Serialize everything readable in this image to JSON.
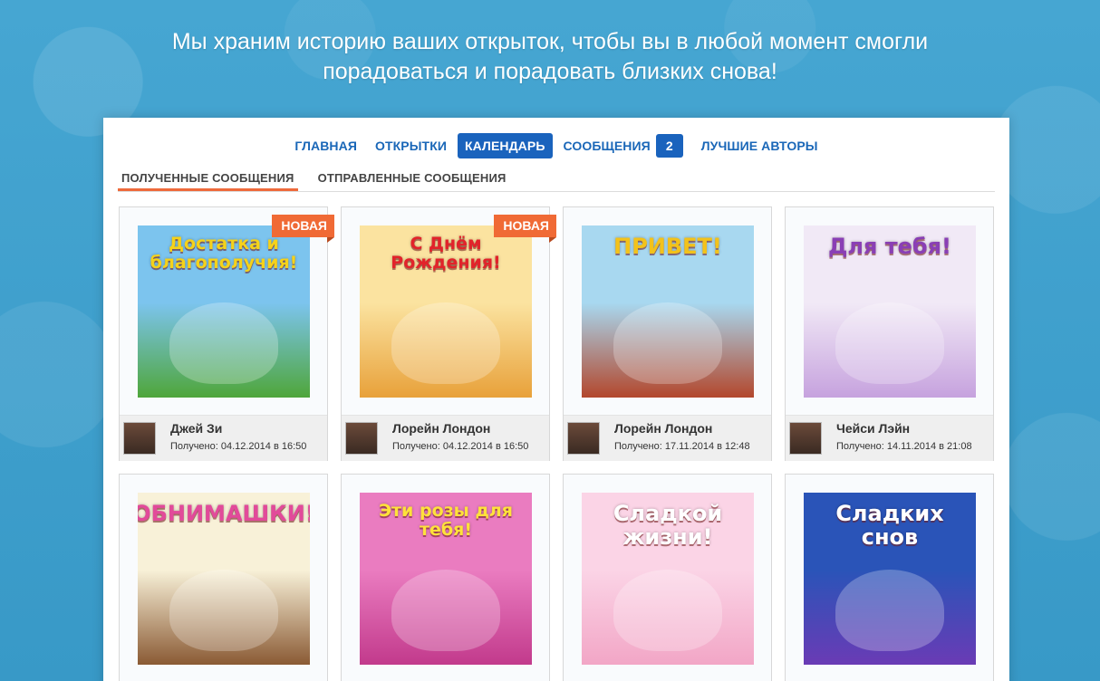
{
  "headline": {
    "line1": "Мы храним историю ваших открыток, чтобы вы в любой момент смогли",
    "line2": "порадоваться и порадовать близких снова!"
  },
  "nav": {
    "items": [
      {
        "label": "ГЛАВНАЯ"
      },
      {
        "label": "ОТКРЫТКИ"
      },
      {
        "label": "КАЛЕНДАРЬ",
        "active": true
      },
      {
        "label": "СООБЩЕНИЯ",
        "badge": "2"
      },
      {
        "label": "ЛУЧШИЕ АВТОРЫ"
      }
    ]
  },
  "subtabs": {
    "received": "ПОЛУЧЕННЫЕ СООБЩЕНИЯ",
    "sent": "ОТПРАВЛЕННЫЕ СООБЩЕНИЯ"
  },
  "badge_new": "НОВАЯ",
  "cards": [
    {
      "image_text": "Достатка и благополучия!",
      "new": true,
      "sender": "Джей Зи",
      "received": "Получено: 04.12.2014 в 16:50",
      "bg": "#4fa63a",
      "sky": "#7cc4ee",
      "text_color": "#f5d21a"
    },
    {
      "image_text": "С Днём Рождения!",
      "new": true,
      "sender": "Лорейн Лондон",
      "received": "Получено: 04.12.2014 в 16:50",
      "bg": "#e8a13a",
      "sky": "#fbe3a0",
      "text_color": "#e2232a"
    },
    {
      "image_text": "ПРИВЕТ!",
      "new": false,
      "sender": "Лорейн Лондон",
      "received": "Получено: 17.11.2014 в 12:48",
      "bg": "#b3472c",
      "sky": "#a8d8f0",
      "text_color": "#f3c21a"
    },
    {
      "image_text": "Для тебя!",
      "new": false,
      "sender": "Чейси Лэйн",
      "received": "Получено: 14.11.2014 в 21:08",
      "bg": "#c6a2de",
      "sky": "#f1e9f6",
      "text_color": "#8a3fb5"
    },
    {
      "image_text": "ОБНИМАШКИ!",
      "new": false,
      "bg": "#8a5a34",
      "sky": "#f8f1d8",
      "text_color": "#e24a9a"
    },
    {
      "image_text": "Эти розы для тебя!",
      "new": false,
      "bg": "#c23a8c",
      "sky": "#ea7cc0",
      "text_color": "#ffe23a"
    },
    {
      "image_text": "Сладкой жизни!",
      "new": false,
      "bg": "#f2a6c6",
      "sky": "#fbd4e6",
      "text_color": "#ffffff"
    },
    {
      "image_text": "Сладких снов",
      "new": false,
      "bg": "#6a3bb5",
      "sky": "#2a54b8",
      "text_color": "#ffffff"
    }
  ]
}
